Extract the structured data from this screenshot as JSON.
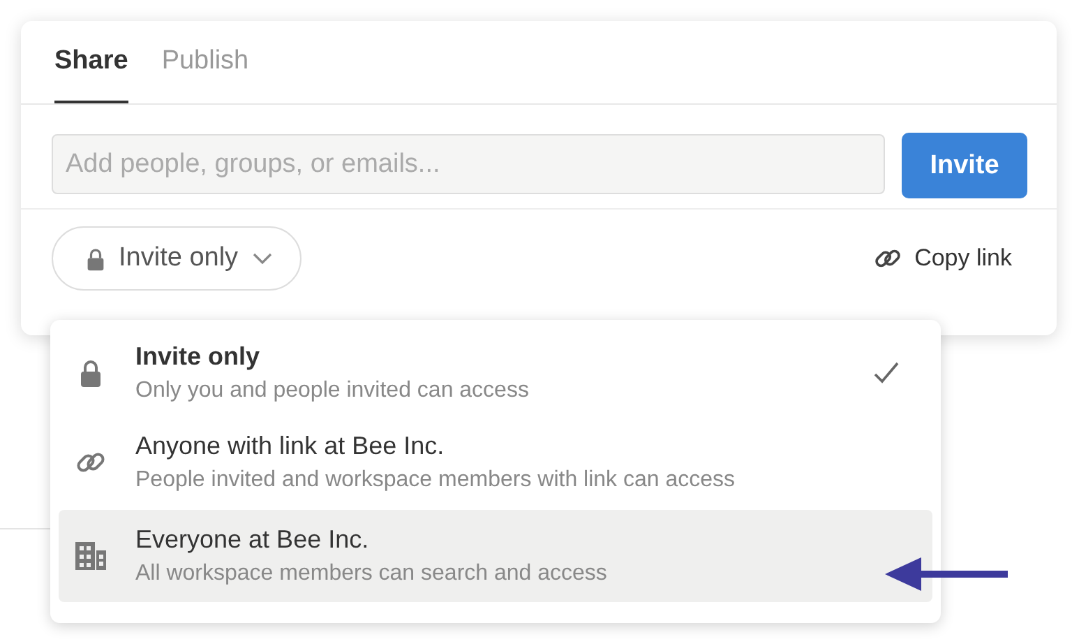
{
  "tabs": [
    {
      "label": "Share",
      "selected": true
    },
    {
      "label": "Publish",
      "selected": false
    }
  ],
  "invite_field": {
    "placeholder": "Add people, groups, or emails..."
  },
  "invite_button": "Invite",
  "access_dropdown": {
    "label": "Invite only",
    "expanded": true
  },
  "copy_link": "Copy link",
  "access_options": [
    {
      "title": "Invite only",
      "description": "Only you and people invited can access",
      "selected": true,
      "highlighted": false
    },
    {
      "title": "Anyone with link at Bee Inc.",
      "description": "People invited and workspace members with link can access",
      "selected": false,
      "highlighted": false
    },
    {
      "title": "Everyone at Bee Inc.",
      "description": "All workspace members can search and access",
      "selected": false,
      "highlighted": true
    }
  ]
}
